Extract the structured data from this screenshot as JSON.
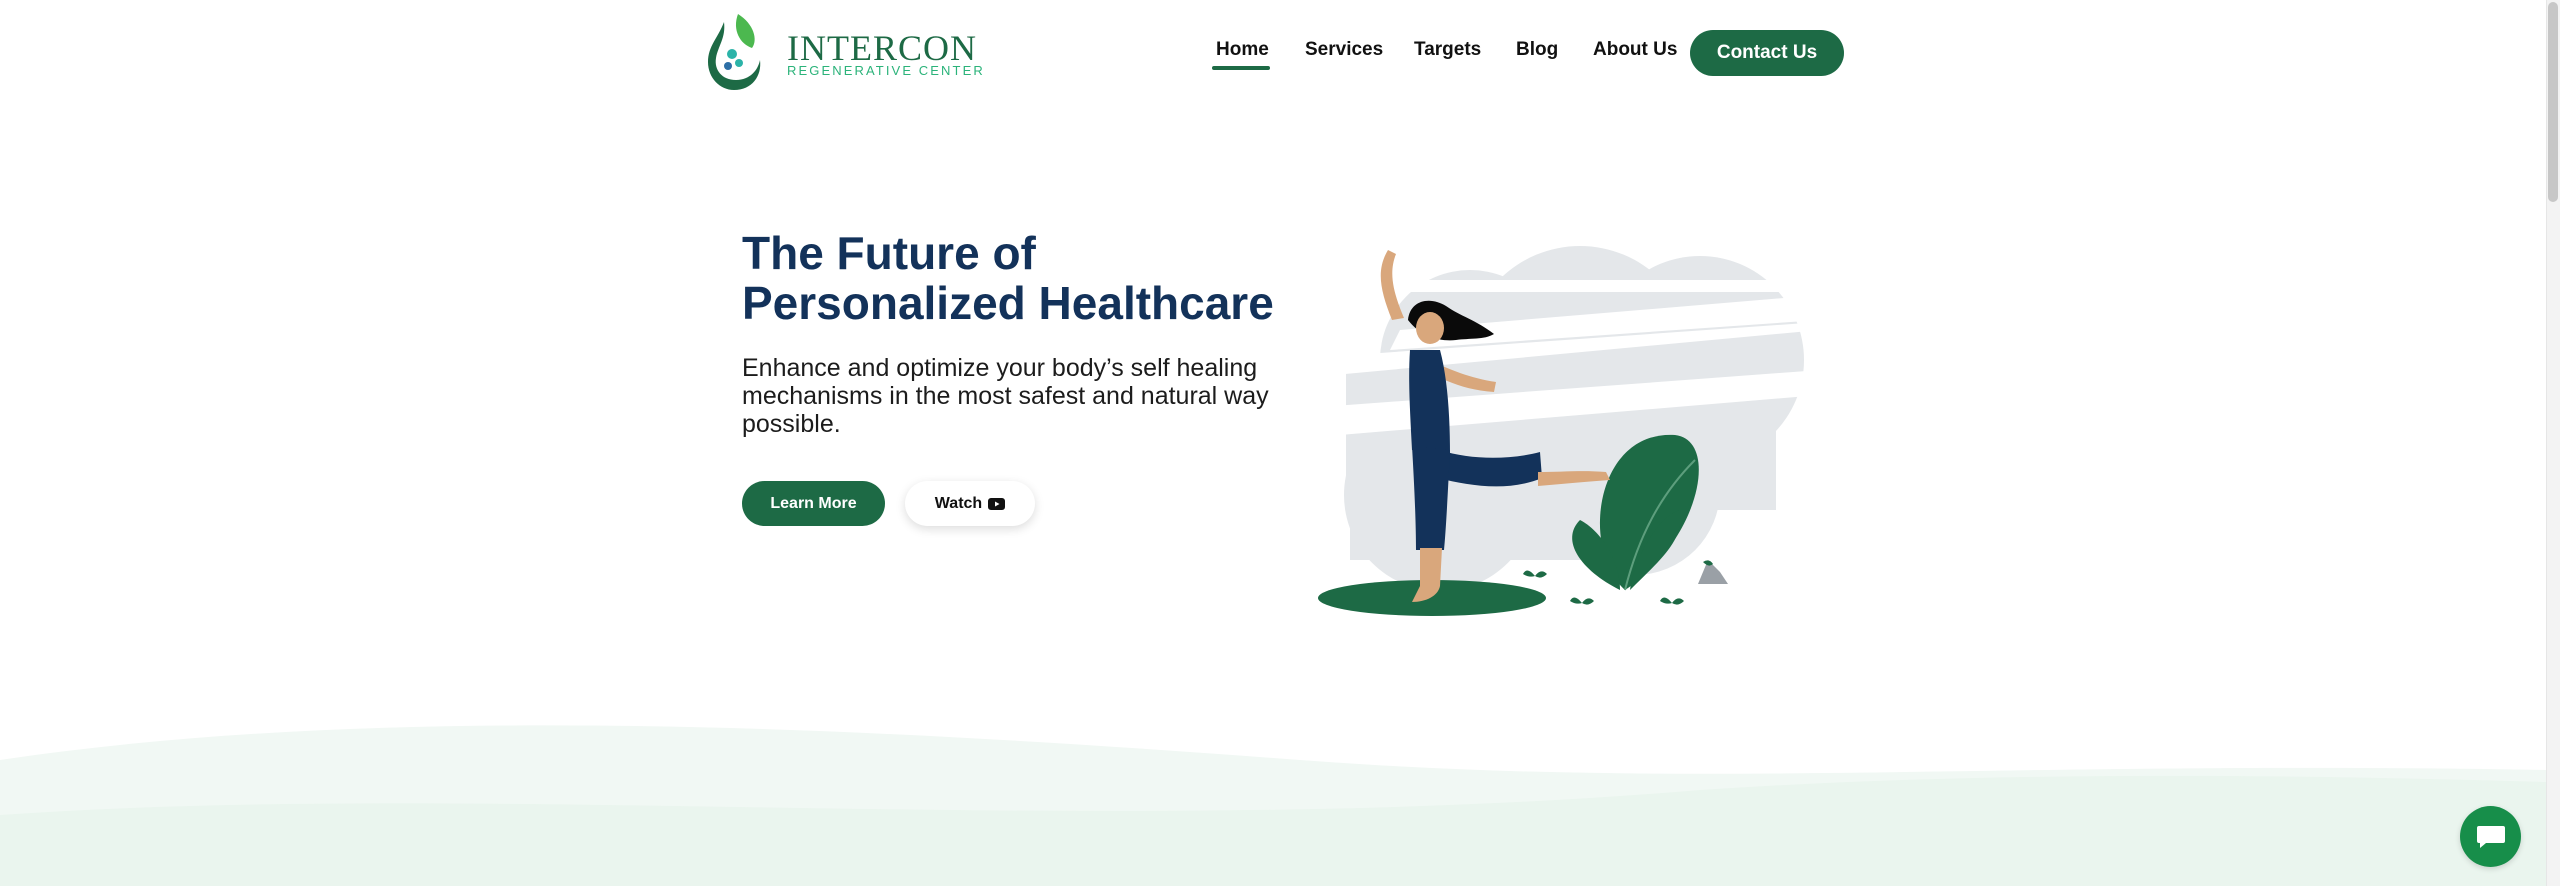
{
  "brand": {
    "name": "INTERCON",
    "tagline": "REGENERATIVE CENTER",
    "primary_color": "#1d6a45",
    "accent_color": "#2bb37a",
    "icon": "leaf-drop-logo-icon"
  },
  "nav": {
    "items": [
      {
        "label": "Home",
        "active": true
      },
      {
        "label": "Services",
        "active": false
      },
      {
        "label": "Targets",
        "active": false
      },
      {
        "label": "Blog",
        "active": false
      },
      {
        "label": "About Us",
        "active": false
      }
    ],
    "cta_label": "Contact Us"
  },
  "hero": {
    "title": "The Future of Personalized Healthcare",
    "subtitle": "Enhance and optimize your body’s self healing mechanisms in the most safest and natural way possible.",
    "learn_more_label": "Learn More",
    "watch_label": "Watch",
    "watch_icon": "youtube-play-icon",
    "title_color": "#13325a"
  },
  "chat": {
    "icon": "chat-bubble-icon",
    "color": "#178e4a"
  }
}
